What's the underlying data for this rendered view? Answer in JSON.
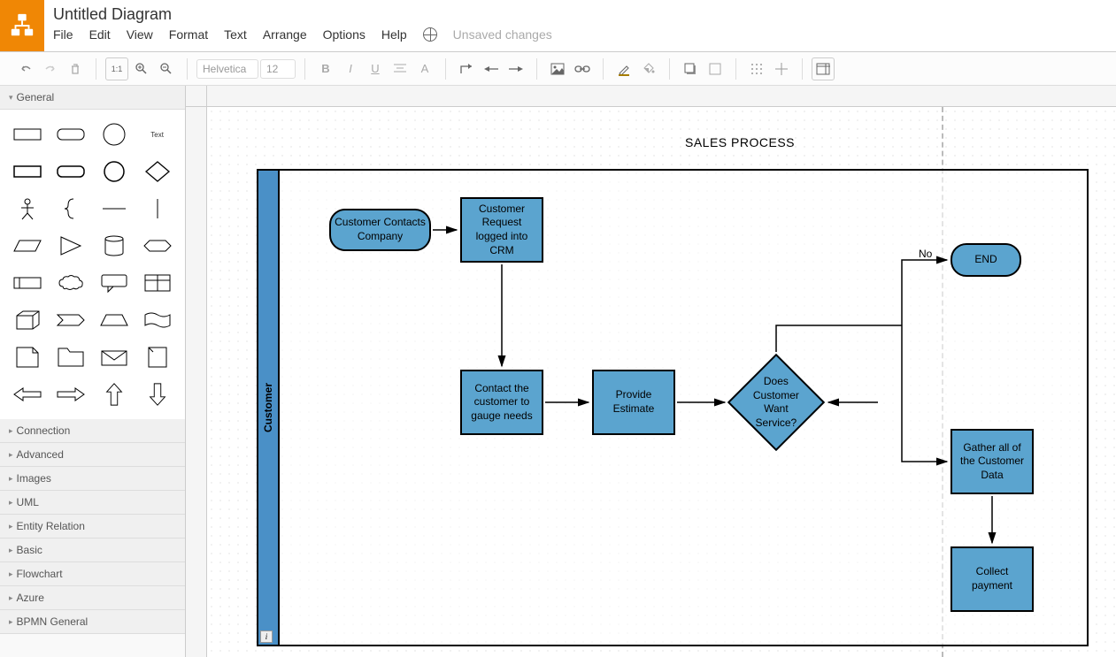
{
  "header": {
    "title": "Untitled Diagram",
    "menu": [
      "File",
      "Edit",
      "View",
      "Format",
      "Text",
      "Arrange",
      "Options",
      "Help"
    ],
    "status": "Unsaved changes"
  },
  "toolbar": {
    "font": "Helvetica",
    "fontSize": "12"
  },
  "sidebar": {
    "panels": [
      "General",
      "Connection",
      "Advanced",
      "Images",
      "UML",
      "Entity Relation",
      "Basic",
      "Flowchart",
      "Azure",
      "BPMN General"
    ],
    "textShapeLabel": "Text"
  },
  "diagram": {
    "title": "SALES PROCESS",
    "poolLabel": "Customer",
    "nodes": {
      "start": "Customer Contacts Company",
      "logCRM": "Customer Request logged into CRM",
      "contact": "Contact the customer to gauge needs",
      "estimate": "Provide Estimate",
      "decision": "Does Customer Want Service?",
      "end": "END",
      "gather": "Gather all of the Customer Data",
      "collect": "Collect payment"
    },
    "edgeLabels": {
      "no": "No"
    }
  }
}
